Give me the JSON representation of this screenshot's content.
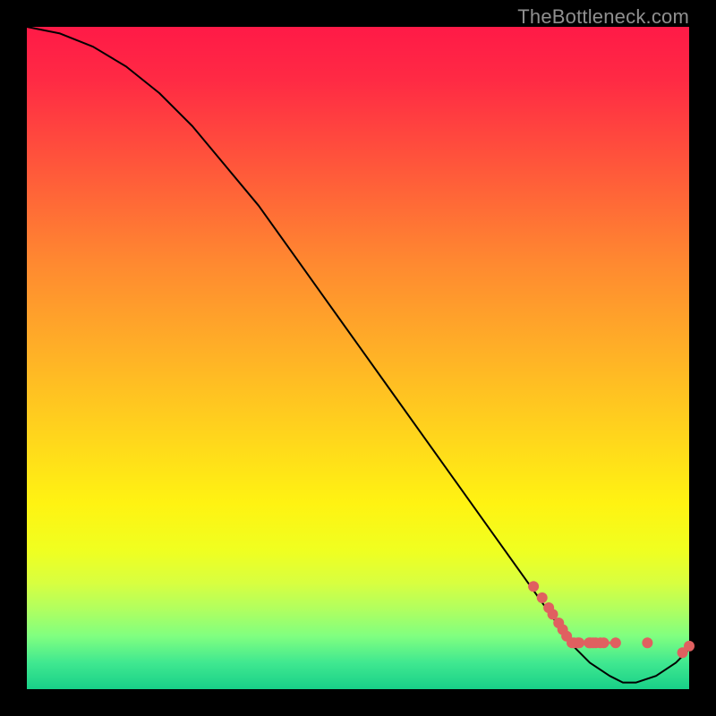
{
  "watermark": "TheBottleneck.com",
  "chart_data": {
    "type": "line",
    "title": "",
    "xlabel": "",
    "ylabel": "",
    "xlim": [
      0,
      100
    ],
    "ylim": [
      0,
      100
    ],
    "grid": false,
    "legend": false,
    "series": [
      {
        "name": "curve",
        "color": "#000000",
        "x": [
          0,
          5,
          10,
          15,
          20,
          25,
          30,
          35,
          40,
          45,
          50,
          55,
          60,
          65,
          70,
          75,
          80,
          82,
          85,
          88,
          90,
          92,
          95,
          98,
          100
        ],
        "y": [
          100,
          99,
          97,
          94,
          90,
          85,
          79,
          73,
          66,
          59,
          52,
          45,
          38,
          31,
          24,
          17,
          10,
          7,
          4,
          2,
          1,
          1,
          2,
          4,
          6
        ]
      }
    ],
    "markers": [
      {
        "x": 76.5,
        "y": 15.5
      },
      {
        "x": 77.8,
        "y": 13.8
      },
      {
        "x": 78.8,
        "y": 12.3
      },
      {
        "x": 79.4,
        "y": 11.3
      },
      {
        "x": 80.3,
        "y": 10.0
      },
      {
        "x": 80.9,
        "y": 9.0
      },
      {
        "x": 81.5,
        "y": 8.0
      },
      {
        "x": 82.3,
        "y": 7.0
      },
      {
        "x": 82.6,
        "y": 7.0
      },
      {
        "x": 83.2,
        "y": 7.0
      },
      {
        "x": 83.4,
        "y": 7.0
      },
      {
        "x": 84.9,
        "y": 7.0
      },
      {
        "x": 85.1,
        "y": 7.0
      },
      {
        "x": 85.5,
        "y": 7.0
      },
      {
        "x": 85.9,
        "y": 7.0
      },
      {
        "x": 86.6,
        "y": 7.0
      },
      {
        "x": 87.1,
        "y": 7.0
      },
      {
        "x": 88.9,
        "y": 7.0
      },
      {
        "x": 93.7,
        "y": 7.0
      },
      {
        "x": 99.0,
        "y": 5.5
      },
      {
        "x": 100.0,
        "y": 6.5
      }
    ],
    "marker_color": "#e06060",
    "marker_radius_px": 6,
    "row_band_y": 7.0
  }
}
